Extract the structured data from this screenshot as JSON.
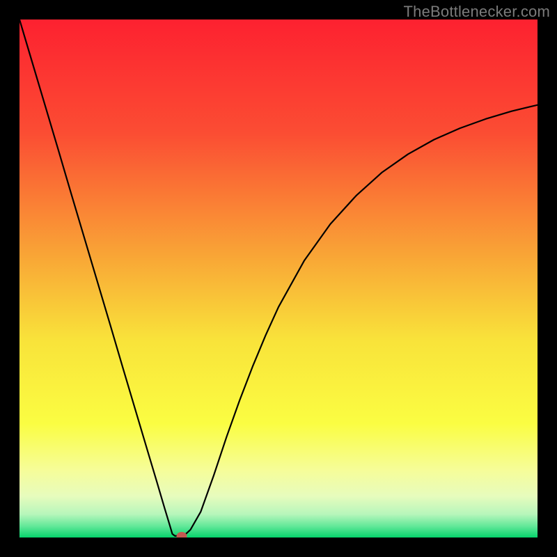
{
  "watermark": "TheBottlenecker.com",
  "chart_data": {
    "type": "line",
    "title": "",
    "xlabel": "",
    "ylabel": "",
    "xlim": [
      0,
      100
    ],
    "ylim": [
      0,
      100
    ],
    "x": [
      0.0,
      2.5,
      5.0,
      7.5,
      10.0,
      12.5,
      15.0,
      17.5,
      20.0,
      22.5,
      25.0,
      26.5,
      28.0,
      29.0,
      29.5,
      30.0,
      30.8,
      31.8,
      33.0,
      35.0,
      37.5,
      40.0,
      42.5,
      45.0,
      47.5,
      50.0,
      55.0,
      60.0,
      65.0,
      70.0,
      75.0,
      80.0,
      85.0,
      90.0,
      95.0,
      100.0
    ],
    "y": [
      100.0,
      91.6,
      83.2,
      74.8,
      66.3,
      57.9,
      49.5,
      41.1,
      32.6,
      24.2,
      15.8,
      10.8,
      5.7,
      2.4,
      0.7,
      0.3,
      0.3,
      0.4,
      1.5,
      5.0,
      12.0,
      19.5,
      26.5,
      33.0,
      39.0,
      44.5,
      53.5,
      60.5,
      66.0,
      70.5,
      74.0,
      76.8,
      79.0,
      80.8,
      82.3,
      83.5
    ],
    "marker": {
      "x": 31.3,
      "y": 0.3
    },
    "gradient_stops": [
      {
        "offset": 0.0,
        "color": "#fd2130"
      },
      {
        "offset": 0.22,
        "color": "#fb4d33"
      },
      {
        "offset": 0.45,
        "color": "#f9a336"
      },
      {
        "offset": 0.62,
        "color": "#f9e33a"
      },
      {
        "offset": 0.78,
        "color": "#fafd42"
      },
      {
        "offset": 0.87,
        "color": "#f6fd99"
      },
      {
        "offset": 0.92,
        "color": "#e7fcbd"
      },
      {
        "offset": 0.955,
        "color": "#b7f6bb"
      },
      {
        "offset": 0.978,
        "color": "#63e899"
      },
      {
        "offset": 1.0,
        "color": "#06d36c"
      }
    ]
  }
}
